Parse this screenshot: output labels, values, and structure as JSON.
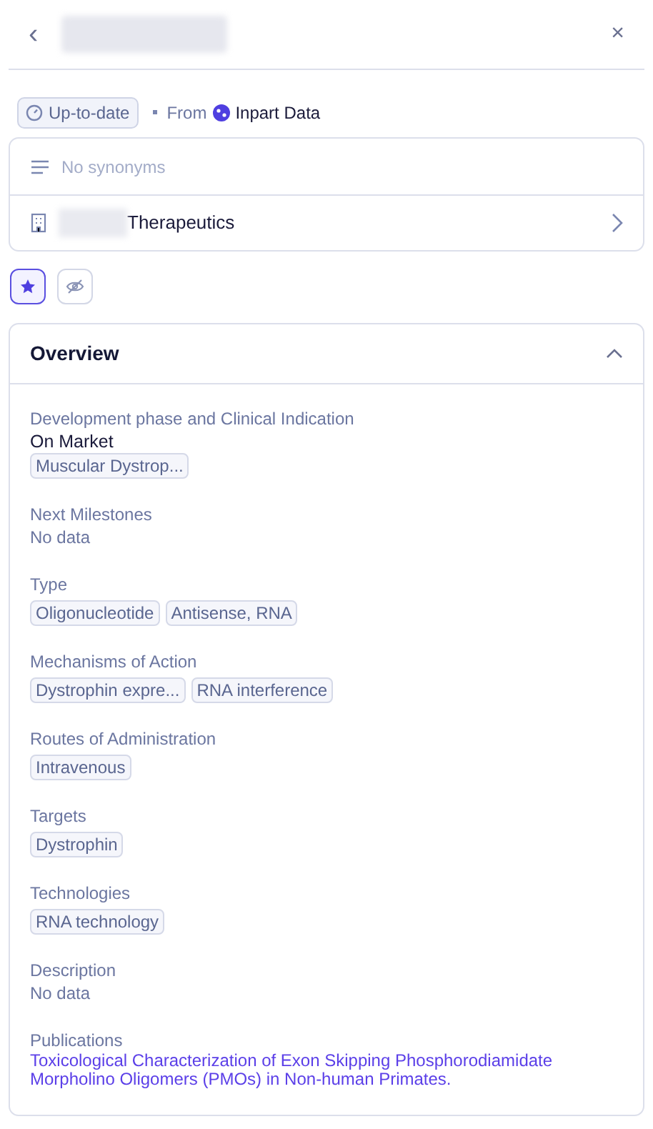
{
  "header": {
    "back": "‹",
    "close": "×"
  },
  "source": {
    "status": "Up-to-date",
    "from_label": "From",
    "provider": "Inpart Data"
  },
  "info_rows": [
    {
      "kind": "synonyms",
      "text": "No synonyms"
    },
    {
      "kind": "company",
      "text": "Therapeutics"
    }
  ],
  "actions": [
    {
      "kind": "star",
      "selected": true
    },
    {
      "kind": "hide",
      "selected": false
    }
  ],
  "overview": {
    "title": "Overview",
    "expanded": true,
    "fields": [
      {
        "kind": "status",
        "label": "Development phase and Clinical Indication",
        "value": "On Market",
        "tags": [
          "Muscular Dystrop..."
        ]
      },
      {
        "kind": "empty",
        "label": "Next Milestones",
        "value": "No data"
      },
      {
        "kind": "tags",
        "label": "Type",
        "tags": [
          "Oligonucleotide",
          "Antisense, RNA"
        ]
      },
      {
        "kind": "tags",
        "label": "Mechanisms of Action",
        "tags": [
          "Dystrophin expre...",
          "RNA interference"
        ]
      },
      {
        "kind": "tags",
        "label": "Routes of Administration",
        "tags": [
          "Intravenous"
        ]
      },
      {
        "kind": "tags",
        "label": "Targets",
        "tags": [
          "Dystrophin"
        ]
      },
      {
        "kind": "tags",
        "label": "Technologies",
        "tags": [
          "RNA technology"
        ]
      },
      {
        "kind": "empty",
        "label": "Description",
        "value": "No data"
      },
      {
        "kind": "link",
        "label": "Publications",
        "value": "Toxicological Characterization of Exon Skipping Phosphorodiamidate Morpholino Oligomers (PMOs) in Non-human Primates."
      }
    ]
  }
}
